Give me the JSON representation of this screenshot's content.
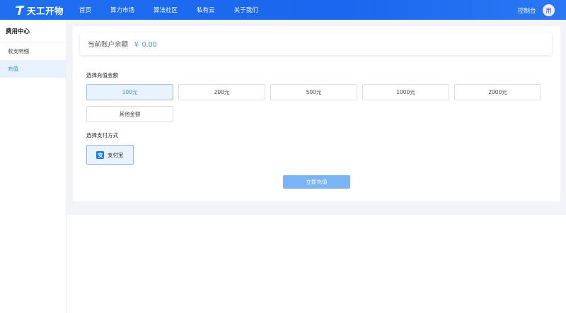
{
  "brand": {
    "name": "天工开物",
    "colors": {
      "accent": "#2f8bff",
      "nav": "#1f6ff0"
    }
  },
  "nav": {
    "items": [
      "首页",
      "算力市场",
      "算法社区",
      "私有云",
      "关于我们"
    ],
    "console": "控制台",
    "avatar": "用"
  },
  "sidebar": {
    "title": "费用中心",
    "items": [
      {
        "label": "收支明细",
        "active": false
      },
      {
        "label": "充值",
        "active": true
      }
    ]
  },
  "balance": {
    "label": "当前账户余额",
    "value": "￥ 0.00"
  },
  "recharge": {
    "amount_label": "选择充值金额",
    "amounts": [
      "100元",
      "200元",
      "500元",
      "1000元",
      "2000元",
      "其他金额"
    ],
    "selected_amount": "100元",
    "payment_label": "选择支付方式",
    "payment_option": "支付宝",
    "payment_icon": "alipay-icon",
    "submit": "立即充值"
  }
}
